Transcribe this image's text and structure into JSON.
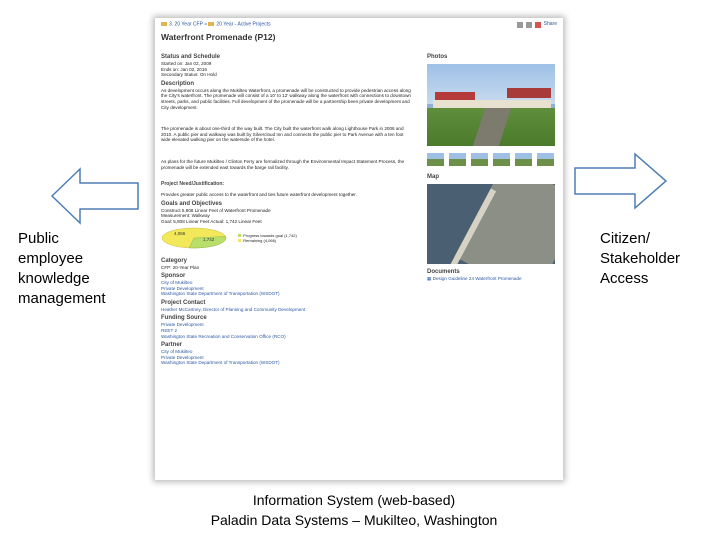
{
  "side_labels": {
    "left": [
      "Public",
      "employee",
      "knowledge",
      "management"
    ],
    "right": [
      "Citizen/",
      "Stakeholder",
      "Access"
    ]
  },
  "caption": {
    "line1": "Information System (web-based)",
    "line2": "Paladin Data Systems – Mukilteo, Washington"
  },
  "colors": {
    "arrow_stroke": "#4f7fb5",
    "link": "#2a57a3",
    "pie_yellow": "#f3e85a",
    "pie_green": "#b9de6a"
  },
  "page": {
    "breadcrumb_1": "3. 20 Year CFP",
    "breadcrumb_sep": "»",
    "breadcrumb_2": "20 Year - Active Projects",
    "share": "Share",
    "title": "Waterfront Promenade (P12)",
    "status": {
      "heading": "Status and Schedule",
      "started": "Started on: Jan 02, 2009",
      "ends": "Ends on: Jan 02, 2016",
      "secondary": "Secondary Status: On Hold"
    },
    "description": {
      "heading": "Description",
      "p1": "As development occurs along the Mukilteo Waterfront, a promenade will be constructed to provide pedestrian access along the City's waterfront. The promenade will consist of a 10' to 12' walkway along the waterfront with connections to downtown streets, parks, and public facilities. Full development of the promenade will be a partnership been private development and City development.",
      "p2": "The promenade is about one-third of the way built. The City built the waterfront walk along Lighthouse Park in 2006 and 2010. A public pier and walkway was built by Silvercloud Inn and connects the public pier to Park Avenue with a ten foot wide elevated walking pier on the waterside of the hotel.",
      "p3": "As plans for the future Mukilteo / Clinton Ferry are formalized through the Environmental Impact Statement Process, the promenade will be extended east towards the barge rail facility."
    },
    "need": {
      "heading": "Project Need/Justification:",
      "text": "Provides greater public access to the waterfront and ties future waterfront development together."
    },
    "goals": {
      "heading": "Goals and Objectives",
      "text": "Construct 5,808 Linear Feet of Waterfront Promenade",
      "measurement": "Measurement: Walkway",
      "goal_actual": "Goal: 5,808 Linear Feet   Actual: 1,742 Linear Feet",
      "pie_remaining_label": "4,066",
      "pie_progress_label": "1,742",
      "legend_progress": "Progress towards goal (1,742)",
      "legend_remaining": "Remaining (4,066)",
      "pie_progress_value": 1742,
      "pie_remaining_value": 4066
    },
    "category": {
      "heading": "Category",
      "text": "CFP: 20-Year Plan"
    },
    "sponsor": {
      "heading": "Sponsor",
      "items": [
        "City of Mukilteo",
        "Private Development",
        "Washington State Department of Transportation (WSDOT)"
      ]
    },
    "contact": {
      "heading": "Project Contact",
      "text": "Heather McCartney, Director of Planning and Community Development"
    },
    "funding": {
      "heading": "Funding Source",
      "items": [
        "Private Development",
        "REET 2",
        "Washington State Recreation and Conservation Office (RCO)"
      ]
    },
    "partner": {
      "heading": "Partner",
      "items": [
        "City of Mukilteo",
        "Private Development",
        "Washington State Department of Transportation (WSDOT)"
      ]
    },
    "photos_heading": "Photos",
    "map_heading": "Map",
    "documents": {
      "heading": "Documents",
      "item": "Design Guideline 24 Waterfront Promenade"
    }
  }
}
